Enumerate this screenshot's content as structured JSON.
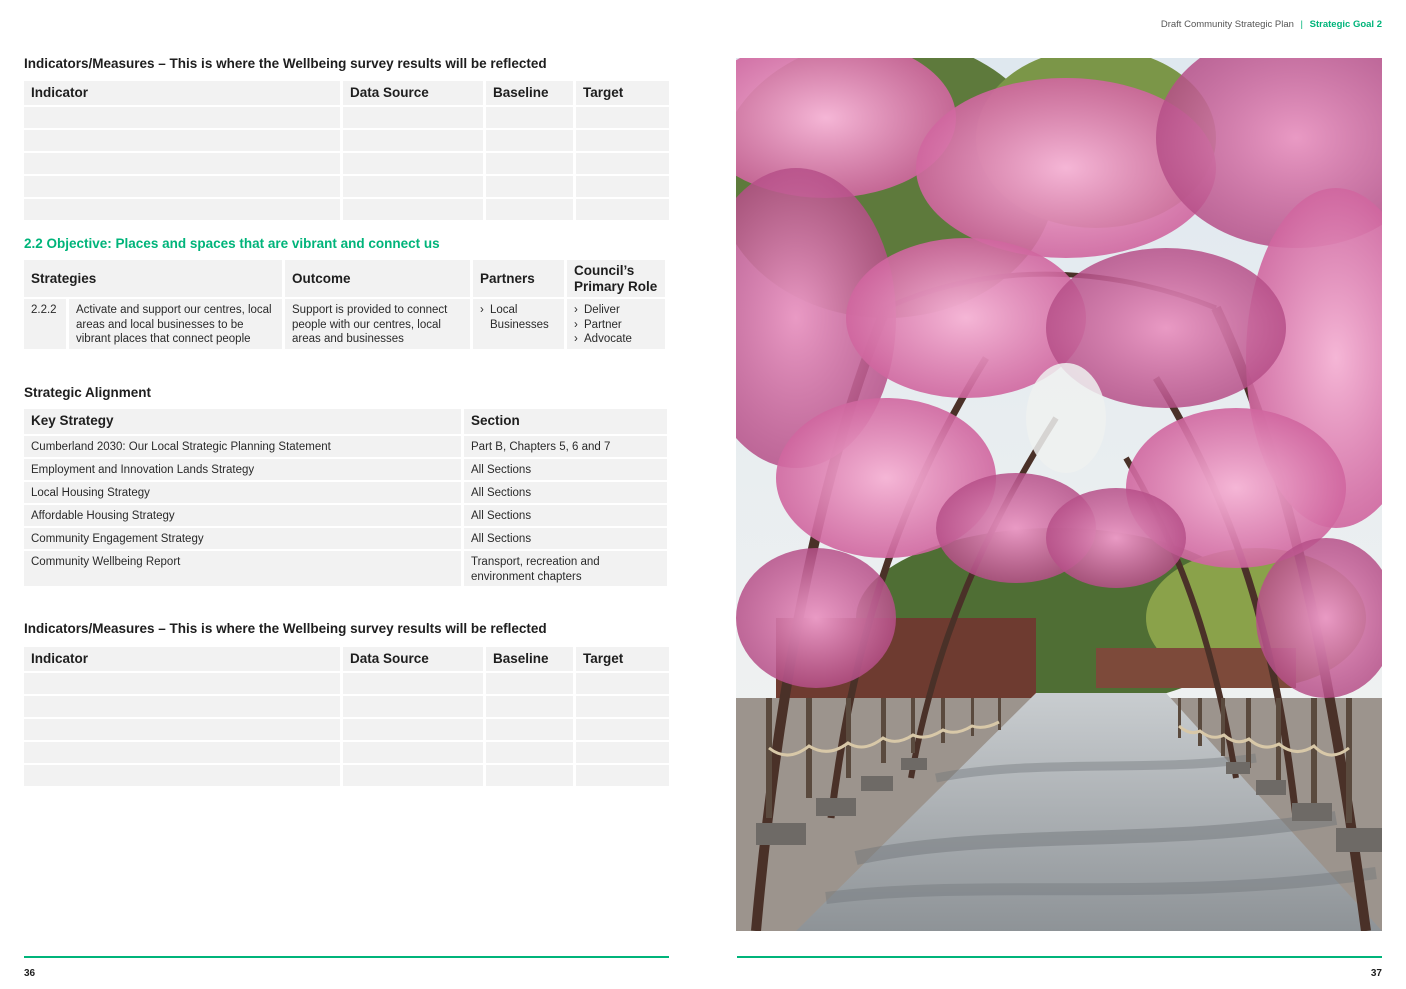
{
  "header": {
    "doc_title": "Draft Community Strategic Plan",
    "separator": "|",
    "goal": "Strategic Goal 2"
  },
  "indicators_top": {
    "heading": "Indicators/Measures – This is where the Wellbeing survey results will be reflected",
    "columns": [
      "Indicator",
      "Data Source",
      "Baseline",
      "Target"
    ],
    "empty_rows": 5
  },
  "objective": {
    "heading": "2.2 Objective: Places and spaces that are vibrant and connect us",
    "columns": [
      "Strategies",
      "Outcome",
      "Partners",
      "Council’s Primary Role"
    ],
    "rows": [
      {
        "number": "2.2.2",
        "strategy": "Activate and support our centres, local areas and local businesses to be vibrant places that connect people",
        "outcome": "Support is provided to connect people with our centres, local areas and businesses",
        "partners": [
          "Local Businesses"
        ],
        "roles": [
          "Deliver",
          "Partner",
          "Advocate"
        ]
      }
    ]
  },
  "alignment": {
    "heading": "Strategic Alignment",
    "columns": [
      "Key Strategy",
      "Section"
    ],
    "rows": [
      {
        "strategy": "Cumberland 2030: Our Local Strategic Planning Statement",
        "section": "Part B, Chapters 5, 6 and 7"
      },
      {
        "strategy": "Employment and Innovation Lands Strategy",
        "section": "All Sections"
      },
      {
        "strategy": "Local Housing Strategy",
        "section": "All Sections"
      },
      {
        "strategy": "Affordable Housing Strategy",
        "section": "All Sections"
      },
      {
        "strategy": "Community Engagement Strategy",
        "section": "All Sections"
      },
      {
        "strategy": "Community Wellbeing Report",
        "section": "Transport, recreation and environment chapters"
      }
    ]
  },
  "indicators_bottom": {
    "heading": "Indicators/Measures – This is where the Wellbeing survey results will be reflected",
    "columns": [
      "Indicator",
      "Data Source",
      "Baseline",
      "Target"
    ],
    "empty_rows": 5
  },
  "footer": {
    "left_page": "36",
    "right_page": "37"
  },
  "colors": {
    "accent": "#00b47a",
    "cell_bg": "#f2f2f2",
    "text": "#1e1e1e"
  },
  "bullet_icon": "chevron-right-icon"
}
